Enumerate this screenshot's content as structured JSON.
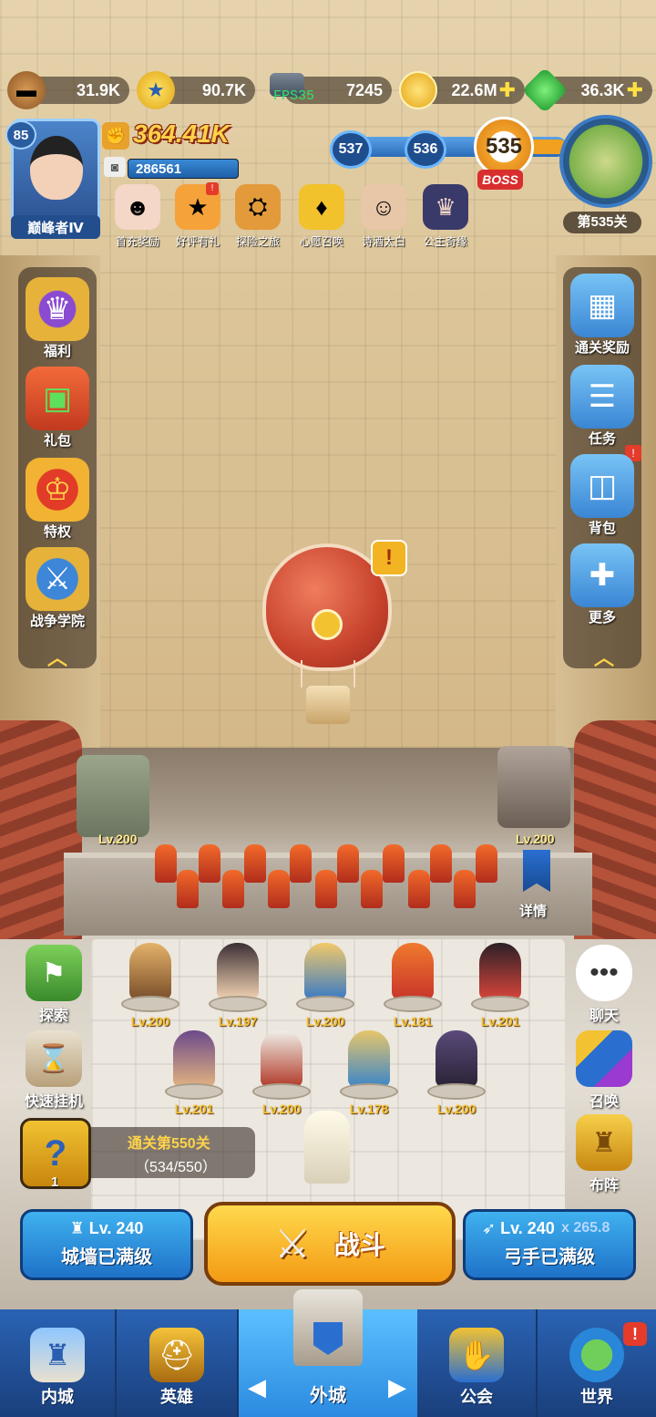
{
  "resources": {
    "wood": {
      "value": "31.9K",
      "icon": "wood-log-icon"
    },
    "stars": {
      "value": "90.7K",
      "icon": "star-coin-icon"
    },
    "iron": {
      "value": "7245",
      "icon": "iron-ingot-icon"
    },
    "gold": {
      "value": "22.6M",
      "icon": "gold-coin-icon"
    },
    "gems": {
      "value": "36.3K",
      "icon": "green-gem-icon"
    },
    "fps": "FPS35"
  },
  "player": {
    "level": "85",
    "rank": "巅峰者Ⅳ",
    "power": "364.41K",
    "id": "286561"
  },
  "events": [
    {
      "label": "首充奖励",
      "icon": "first-recharge-icon"
    },
    {
      "label": "好评有礼",
      "icon": "review-gift-icon",
      "badge": "!"
    },
    {
      "label": "探险之旅",
      "icon": "adventure-icon"
    },
    {
      "label": "心愿召唤",
      "icon": "wish-summon-icon"
    },
    {
      "label": "诗酒太白",
      "icon": "poet-hero-icon"
    },
    {
      "label": "公主奇缘",
      "icon": "princess-icon"
    }
  ],
  "stages": {
    "prev2": "537",
    "prev1": "536",
    "current": "535",
    "boss_label": "BOSS",
    "map_label": "第535关"
  },
  "left_menu": [
    {
      "label": "福利",
      "icon": "crown-badge-icon"
    },
    {
      "label": "礼包",
      "icon": "gift-box-icon"
    },
    {
      "label": "特权",
      "icon": "privilege-crown-icon"
    },
    {
      "label": "战争学院",
      "icon": "war-academy-icon"
    }
  ],
  "right_menu": [
    {
      "label": "通关奖励",
      "icon": "clear-reward-icon"
    },
    {
      "label": "任务",
      "icon": "task-list-icon"
    },
    {
      "label": "背包",
      "icon": "backpack-icon",
      "badge": "!"
    },
    {
      "label": "更多",
      "icon": "more-dpad-icon"
    }
  ],
  "balloon_alert": "!",
  "towers": {
    "left_level": "Lv.200",
    "right_level": "Lv.200",
    "detail_label": "详情"
  },
  "heroes_row1": [
    "Lv.200",
    "Lv.197",
    "Lv.200",
    "Lv.181",
    "Lv.201"
  ],
  "heroes_row2": [
    "Lv.201",
    "Lv.200",
    "Lv.178",
    "Lv.200"
  ],
  "actions_left": [
    {
      "label": "探索",
      "icon": "explore-map-icon"
    },
    {
      "label": "快速挂机",
      "icon": "hourglass-icon"
    }
  ],
  "actions_right": [
    {
      "label": "聊天",
      "icon": "chat-bubble-icon"
    },
    {
      "label": "召唤",
      "icon": "summon-cards-icon"
    },
    {
      "label": "布阵",
      "icon": "formation-tower-icon"
    }
  ],
  "quest": {
    "count": "1",
    "title": "通关第550关",
    "progress": "（534/550）"
  },
  "upgrades": {
    "wall": {
      "level": "Lv. 240",
      "label": "城墙已满级"
    },
    "archer": {
      "level": "Lv. 240",
      "label": "弓手已满级",
      "bonus": "x 265.8"
    }
  },
  "fight_label": "战斗",
  "nav": [
    {
      "label": "内城",
      "icon": "inner-city-icon"
    },
    {
      "label": "英雄",
      "icon": "hero-helmet-icon"
    },
    {
      "label": "外城",
      "icon": "outer-city-icon"
    },
    {
      "label": "公会",
      "icon": "guild-handshake-icon"
    },
    {
      "label": "世界",
      "icon": "world-globe-icon",
      "badge": "!"
    }
  ]
}
